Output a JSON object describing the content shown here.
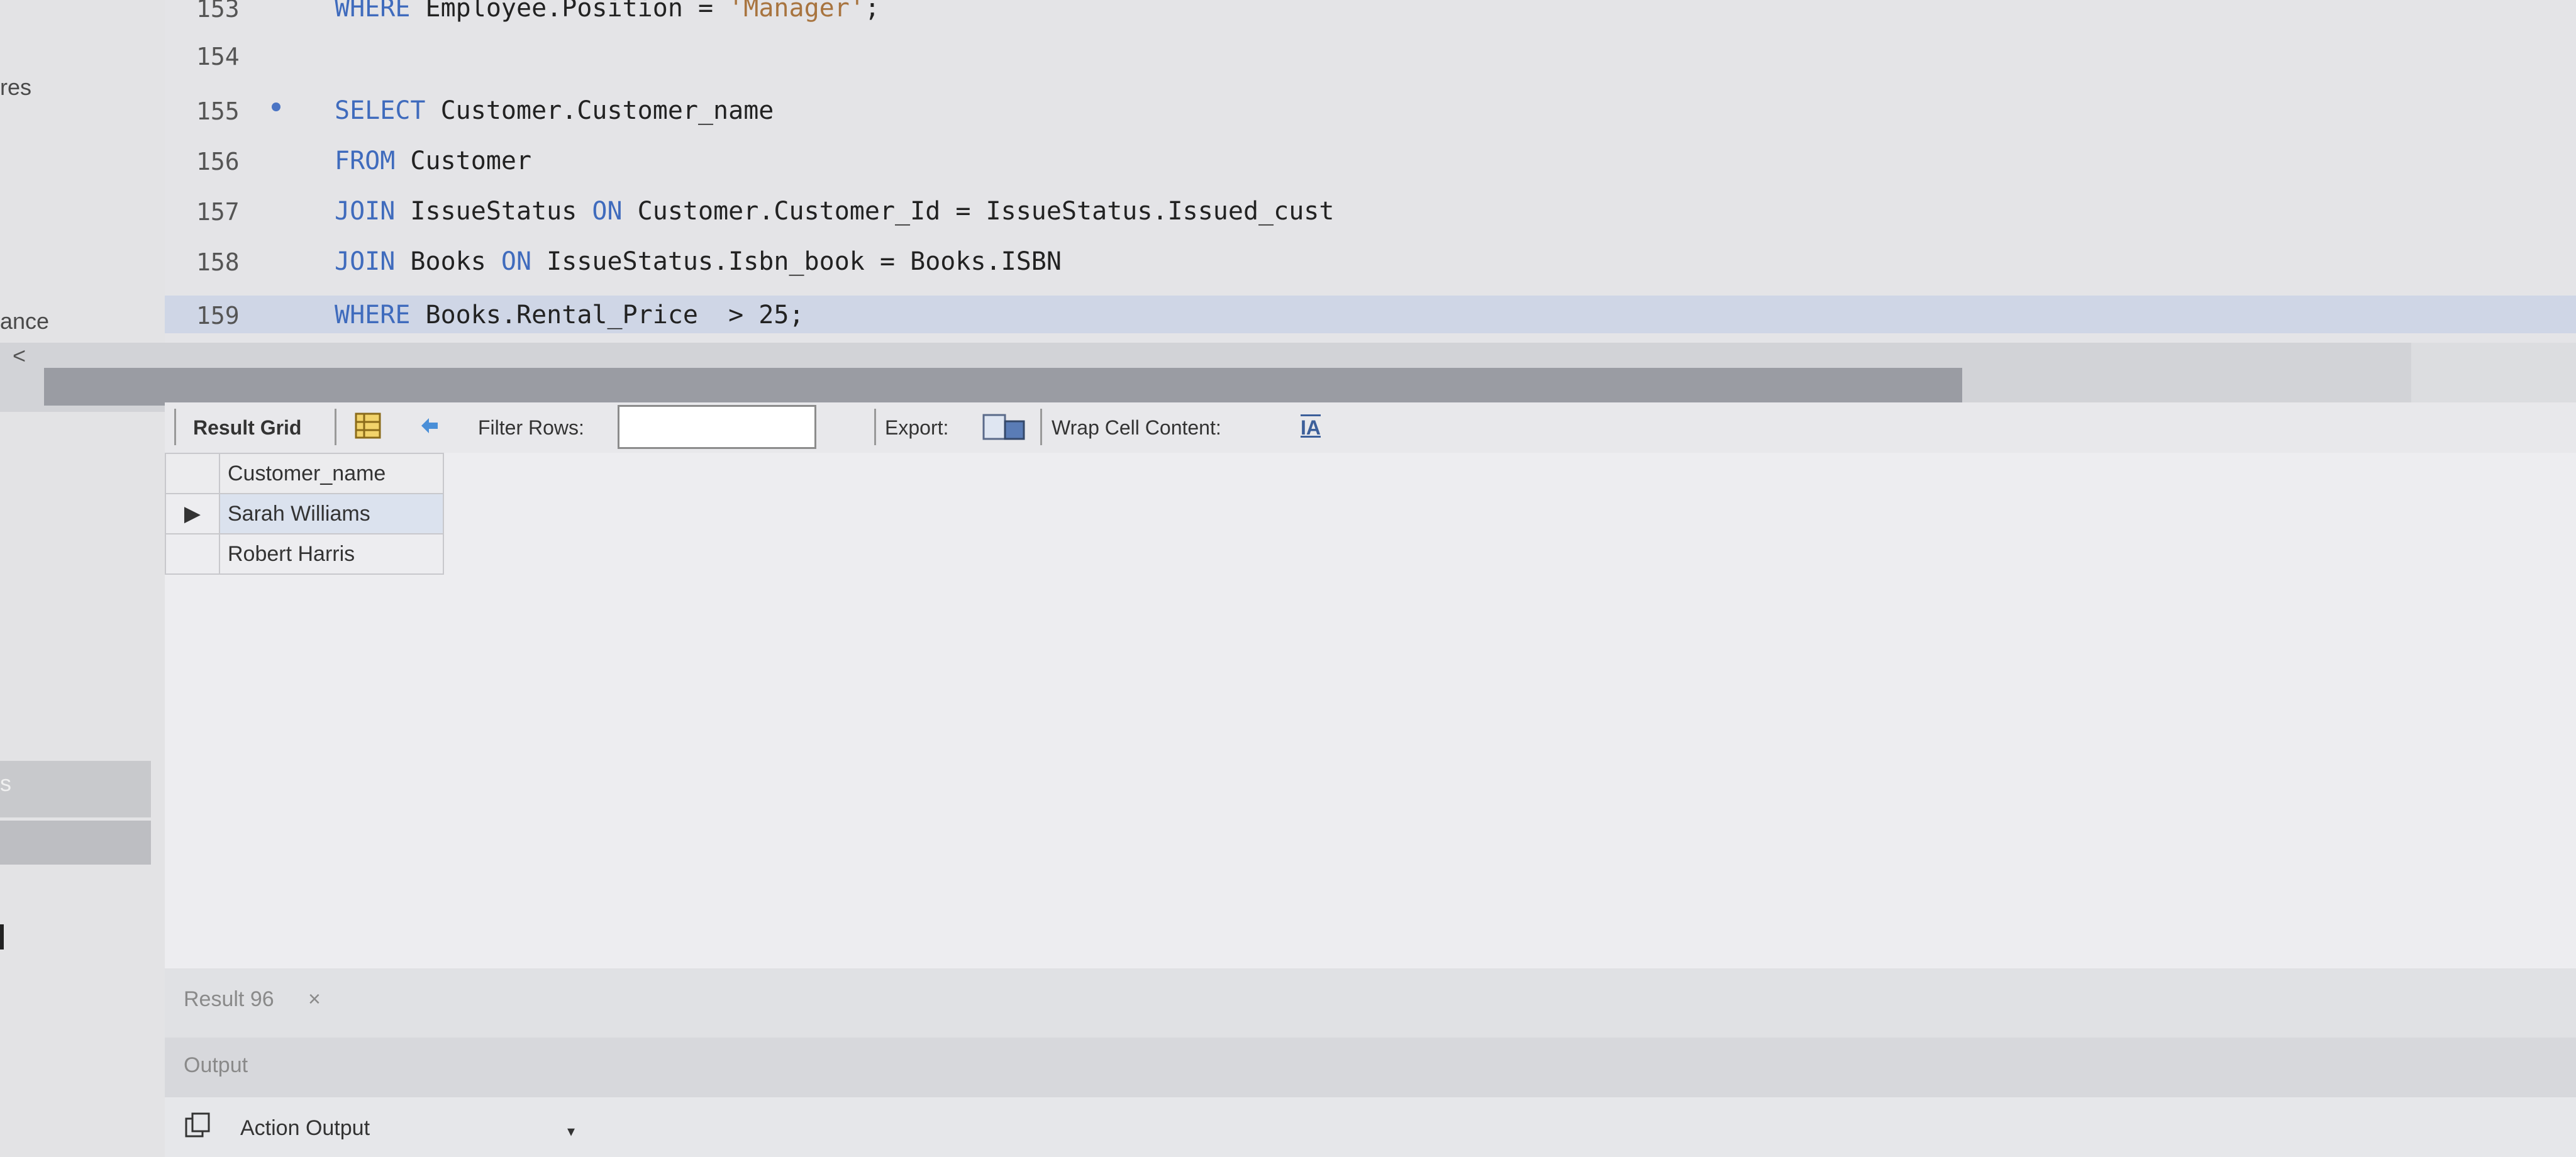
{
  "sidebar": {
    "labels": [
      "res",
      "ance",
      "s"
    ]
  },
  "editor": {
    "lines": [
      {
        "num": "153",
        "tokens": [
          {
            "t": "WHERE",
            "k": "kw"
          },
          {
            "t": " Employee.Position = ",
            "k": ""
          },
          {
            "t": "'Manager'",
            "k": "str"
          },
          {
            "t": ";",
            "k": ""
          }
        ]
      },
      {
        "num": "154",
        "tokens": []
      },
      {
        "num": "155",
        "marker": true,
        "tokens": [
          {
            "t": "SELECT",
            "k": "kw"
          },
          {
            "t": " Customer.Customer_name",
            "k": ""
          }
        ]
      },
      {
        "num": "156",
        "tokens": [
          {
            "t": "FROM",
            "k": "kw"
          },
          {
            "t": " Customer",
            "k": ""
          }
        ]
      },
      {
        "num": "157",
        "tokens": [
          {
            "t": "JOIN",
            "k": "kw"
          },
          {
            "t": " IssueStatus ",
            "k": ""
          },
          {
            "t": "ON",
            "k": "kw"
          },
          {
            "t": " Customer.Customer_Id = IssueStatus.Issued_cust",
            "k": ""
          }
        ]
      },
      {
        "num": "158",
        "tokens": [
          {
            "t": "JOIN",
            "k": "kw"
          },
          {
            "t": " Books ",
            "k": ""
          },
          {
            "t": "ON",
            "k": "kw"
          },
          {
            "t": " IssueStatus.Isbn_book = Books.ISBN",
            "k": ""
          }
        ]
      },
      {
        "num": "159",
        "highlight": true,
        "tokens": [
          {
            "t": "WHERE",
            "k": "kw"
          },
          {
            "t": " Books.Rental_Price  > 25;",
            "k": ""
          }
        ]
      }
    ],
    "scroll_left_glyph": "<"
  },
  "toolbar": {
    "result_grid_label": "Result Grid",
    "filter_rows_label": "Filter Rows:",
    "filter_value": "",
    "export_label": "Export:",
    "wrap_label": "Wrap Cell Content:",
    "wrap_icon_glyph": "IA"
  },
  "grid": {
    "columns": [
      "Customer_name"
    ],
    "rows": [
      [
        "Sarah Williams"
      ],
      [
        "Robert Harris"
      ]
    ],
    "selected_row_indicator": "▶"
  },
  "tabs": {
    "result_label": "Result 96",
    "close_glyph": "×"
  },
  "output": {
    "label": "Output",
    "action_output_label": "Action Output"
  },
  "colors": {
    "keyword": "#3f6bbd",
    "string": "#a8743f"
  }
}
